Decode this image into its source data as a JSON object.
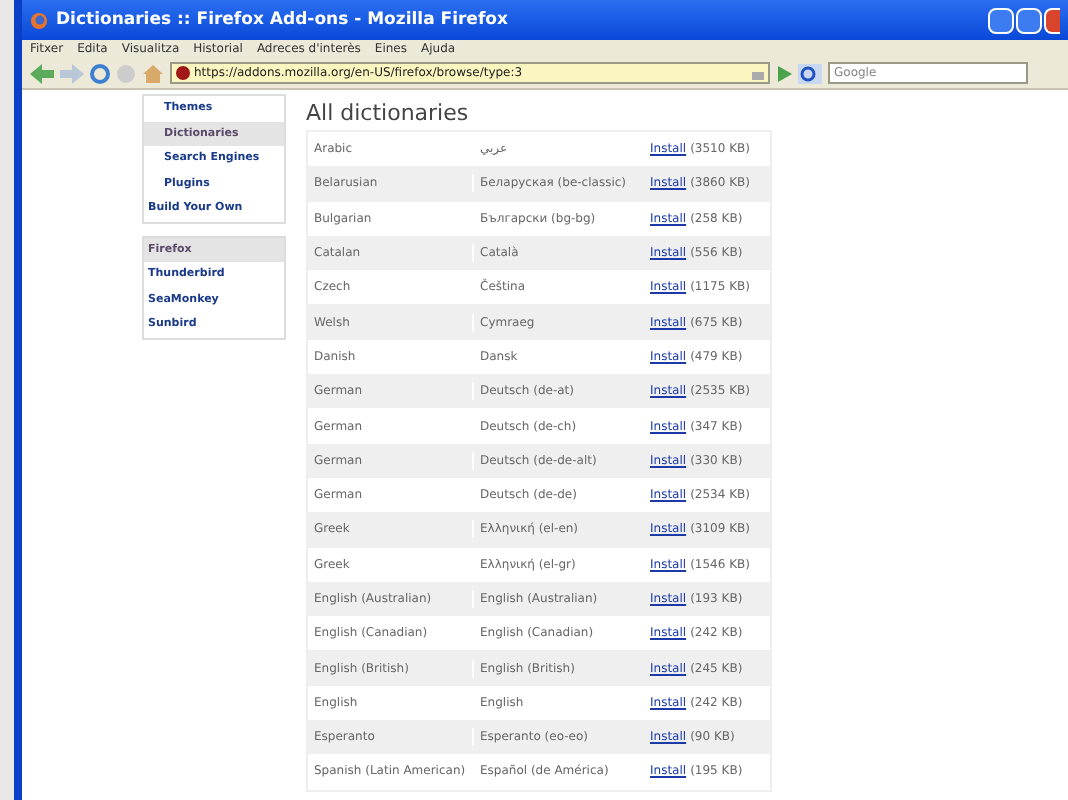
{
  "window": {
    "title": "Dictionaries :: Firefox Add-ons - Mozilla Firefox"
  },
  "menu": [
    "Fitxer",
    "Edita",
    "Visualitza",
    "Historial",
    "Adreces d'interès",
    "Eines",
    "Ajuda"
  ],
  "address_bar": {
    "value": "https://addons.mozilla.org/en-US/firefox/browse/type:3"
  },
  "search": {
    "placeholder": "Google"
  },
  "sidebar": {
    "categories": [
      {
        "label": "Themes",
        "selected": false
      },
      {
        "label": "Dictionaries",
        "selected": true
      },
      {
        "label": "Search Engines",
        "selected": false
      },
      {
        "label": "Plugins",
        "selected": false
      },
      {
        "label": "Build Your Own",
        "selected": false
      }
    ],
    "applications": [
      {
        "label": "Firefox",
        "selected": true
      },
      {
        "label": "Thunderbird",
        "selected": false
      },
      {
        "label": "SeaMonkey",
        "selected": false
      },
      {
        "label": "Sunbird",
        "selected": false
      }
    ]
  },
  "heading": "All dictionaries",
  "rows": [
    {
      "language": "Arabic",
      "native": "عربي",
      "link": "Install",
      "size": "(3510 KB)"
    },
    {
      "language": "Belarusian",
      "native": "Беларуская (be-classic)",
      "link": "Install",
      "size": "(3860 KB)"
    },
    {
      "language": "Bulgarian",
      "native": "Български (bg-bg)",
      "link": "Install",
      "size": "(258 KB)"
    },
    {
      "language": "Catalan",
      "native": "Català",
      "link": "Install",
      "size": "(556 KB)"
    },
    {
      "language": "Czech",
      "native": "Čeština",
      "link": "Install",
      "size": "(1175 KB)"
    },
    {
      "language": "Welsh",
      "native": "Cymraeg",
      "link": "Install",
      "size": "(675 KB)"
    },
    {
      "language": "Danish",
      "native": "Dansk",
      "link": "Install",
      "size": "(479 KB)"
    },
    {
      "language": "German",
      "native": "Deutsch (de-at)",
      "link": "Install",
      "size": "(2535 KB)"
    },
    {
      "language": "German",
      "native": "Deutsch (de-ch)",
      "link": "Install",
      "size": "(347 KB)"
    },
    {
      "language": "German",
      "native": "Deutsch (de-de-alt)",
      "link": "Install",
      "size": "(330 KB)"
    },
    {
      "language": "German",
      "native": "Deutsch (de-de)",
      "link": "Install",
      "size": "(2534 KB)"
    },
    {
      "language": "Greek",
      "native": "Ελληνική (el-en)",
      "link": "Install",
      "size": "(3109 KB)"
    },
    {
      "language": "Greek",
      "native": "Ελληνική (el-gr)",
      "link": "Install",
      "size": "(1546 KB)"
    },
    {
      "language": "English (Australian)",
      "native": "English (Australian)",
      "link": "Install",
      "size": "(193 KB)"
    },
    {
      "language": "English (Canadian)",
      "native": "English (Canadian)",
      "link": "Install",
      "size": "(242 KB)"
    },
    {
      "language": "English (British)",
      "native": "English (British)",
      "link": "Install",
      "size": "(245 KB)"
    },
    {
      "language": "English",
      "native": "English",
      "link": "Install",
      "size": "(242 KB)"
    },
    {
      "language": "Esperanto",
      "native": "Esperanto (eo-eo)",
      "link": "Install",
      "size": "(90 KB)"
    },
    {
      "language": "Spanish (Latin American)",
      "native": "Español (de América)",
      "link": "Install",
      "size": "(195 KB)"
    }
  ]
}
